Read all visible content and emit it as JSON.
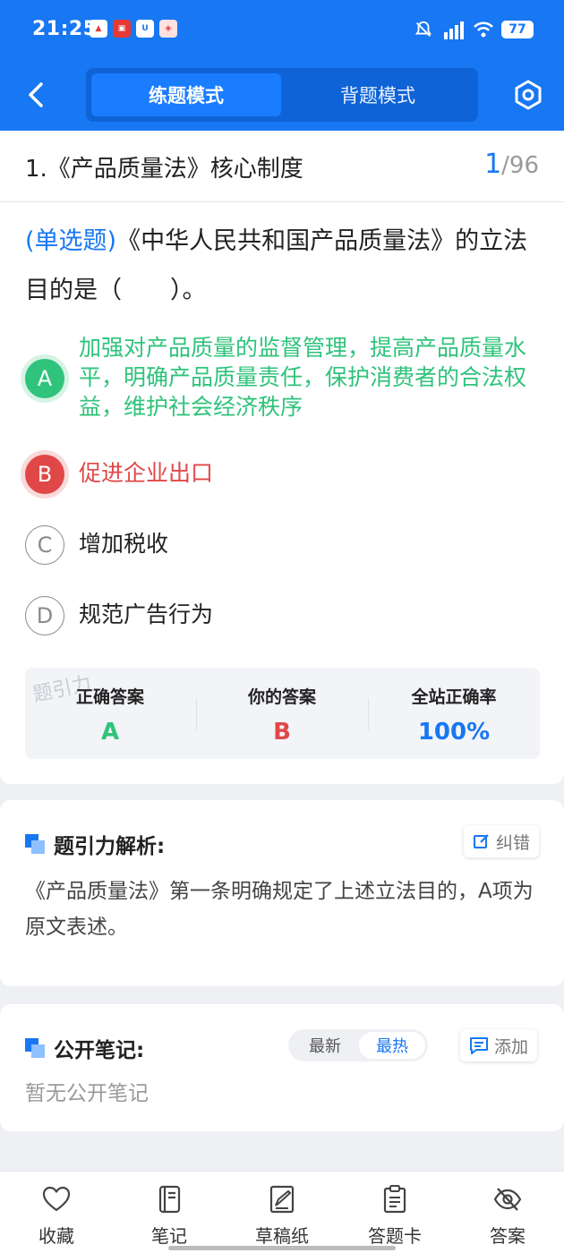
{
  "status": {
    "time": "21:25",
    "battery": "77",
    "signal": "5G"
  },
  "header": {
    "tabs": [
      {
        "label": "练题模式",
        "active": true
      },
      {
        "label": "背题模式",
        "active": false
      }
    ]
  },
  "question": {
    "title": "1.《产品质量法》核心制度",
    "current": "1",
    "total": "/96",
    "type": "(单选题)",
    "stem": "《中华人民共和国产品质量法》的立法目的是（　　）。",
    "options": [
      {
        "letter": "A",
        "text": "加强对产品质量的监督管理，提高产品质量水平，明确产品质量责任，保护消费者的合法权益，维护社会经济秩序",
        "state": "correct"
      },
      {
        "letter": "B",
        "text": "促进企业出口",
        "state": "wrong"
      },
      {
        "letter": "C",
        "text": "增加税收",
        "state": "normal"
      },
      {
        "letter": "D",
        "text": "规范广告行为",
        "state": "normal"
      }
    ]
  },
  "stats": {
    "watermark": "题引力",
    "correct_label": "正确答案",
    "correct_value": "A",
    "yours_label": "你的答案",
    "yours_value": "B",
    "rate_label": "全站正确率",
    "rate_value": "100%"
  },
  "analysis": {
    "title": "题引力解析:",
    "report_label": "纠错",
    "text": "《产品质量法》第一条明确规定了上述立法目的，A项为原文表述。"
  },
  "notes": {
    "title": "公开笔记:",
    "sort_latest": "最新",
    "sort_hot": "最热",
    "add_label": "添加",
    "empty": "暂无公开笔记"
  },
  "bottom_nav": [
    {
      "label": "收藏",
      "icon": "heart-icon"
    },
    {
      "label": "笔记",
      "icon": "notebook-icon"
    },
    {
      "label": "草稿纸",
      "icon": "draft-icon"
    },
    {
      "label": "答题卡",
      "icon": "answer-sheet-icon"
    },
    {
      "label": "答案",
      "icon": "eye-off-icon"
    }
  ],
  "colors": {
    "brand": "#1877f2",
    "correct": "#2fc37b",
    "wrong": "#e04848"
  }
}
